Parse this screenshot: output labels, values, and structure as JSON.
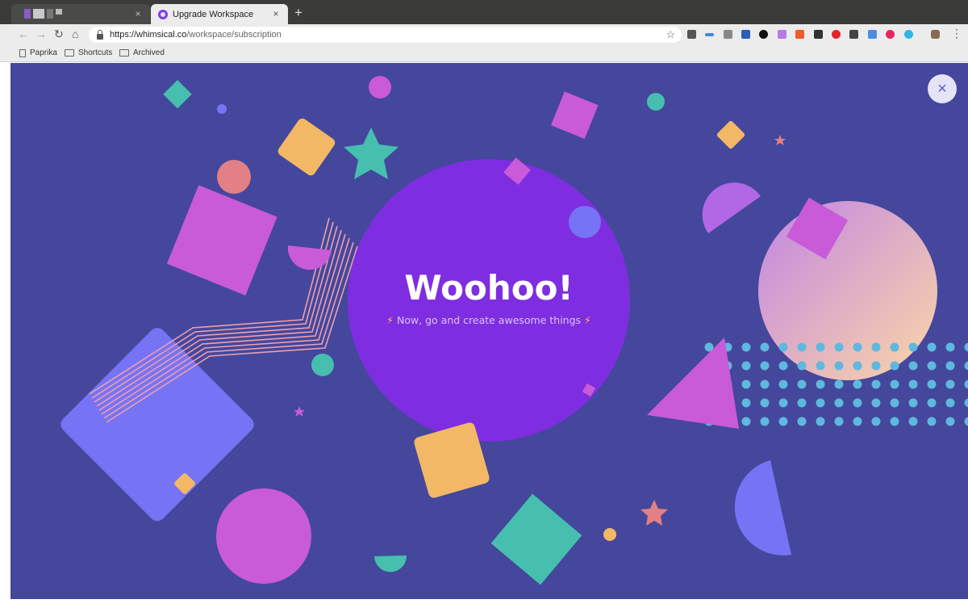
{
  "browser": {
    "tabs": [
      {
        "title": "",
        "close": "×"
      },
      {
        "title": "Upgrade Workspace",
        "close": "×"
      }
    ],
    "new_tab": "+",
    "url_host": "https://whimsical.co",
    "url_path": "/workspace/subscription",
    "bookmarks": [
      "Paprika",
      "Shortcuts",
      "Archived"
    ]
  },
  "modal": {
    "close": "×",
    "title": "Woohoo!",
    "subtitle": "Now, go and create awesome things",
    "bolt": "⚡"
  },
  "colors": {
    "background": "#44479c",
    "purple_circle": "#7e2ee0",
    "magenta": "#c95ad8",
    "orange": "#f3b866",
    "teal": "#46bfaf",
    "periwinkle": "#7673f4",
    "salmon": "#e38085",
    "cyan_dots": "#5fb8de"
  }
}
